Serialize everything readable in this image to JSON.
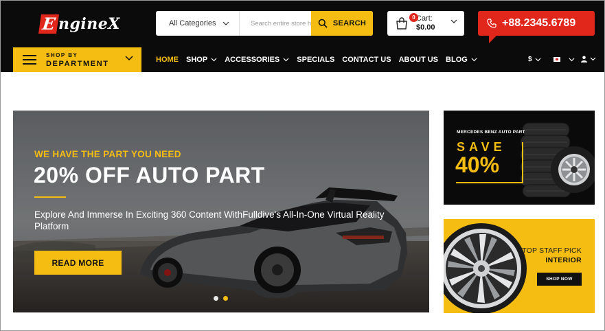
{
  "brand": {
    "logo_initial": "E",
    "logo_rest": "ngineX"
  },
  "search": {
    "category": "All Categories",
    "placeholder": "Search entire store here...",
    "button_label": "SEARCH"
  },
  "cart": {
    "count": "0",
    "label": "Cart:",
    "amount": "$0.00"
  },
  "phone": {
    "number": "+88.2345.6789"
  },
  "department": {
    "small": "SHOP BY",
    "big": "DEPARTMENT"
  },
  "nav": {
    "items": [
      {
        "label": "HOME",
        "active": true,
        "dropdown": false
      },
      {
        "label": "SHOP",
        "active": false,
        "dropdown": true
      },
      {
        "label": "ACCESSORIES",
        "active": false,
        "dropdown": true
      },
      {
        "label": "SPECIALS",
        "active": false,
        "dropdown": false
      },
      {
        "label": "CONTACT US",
        "active": false,
        "dropdown": false
      },
      {
        "label": "ABOUT US",
        "active": false,
        "dropdown": false
      },
      {
        "label": "BLOG",
        "active": false,
        "dropdown": true
      }
    ]
  },
  "utilities": {
    "currency": "$",
    "language_icon": "flag-icon",
    "account_icon": "user-icon"
  },
  "hero": {
    "kicker": "WE HAVE THE PART YOU NEED",
    "title": "20% OFF AUTO PART",
    "description": "Explore And Immerse In Exciting 360 Content WithFulldive's All-In-One Virtual Reality Platform",
    "button_label": "READ MORE",
    "slides": 2,
    "active_slide": 2
  },
  "promo_top": {
    "label": "MERCEDES BENZ AUTO PART",
    "save": "SAVE",
    "percent": "40%"
  },
  "promo_bottom": {
    "line1": "TOP STAFF PICK",
    "line2": "INTERIOR",
    "button_label": "SHOP NOW"
  },
  "colors": {
    "accent": "#f5bd12",
    "brand_red": "#e1261c",
    "header_bg": "#0b0b0b"
  }
}
